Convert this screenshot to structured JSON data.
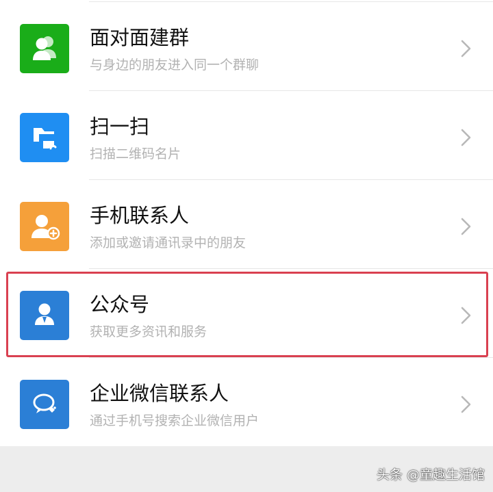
{
  "items": [
    {
      "id": "face-to-face-group",
      "title": "面对面建群",
      "subtitle": "与身边的朋友进入同一个群聊",
      "icon": "face-to-face-group-icon",
      "icon_color": "#1aad19"
    },
    {
      "id": "scan",
      "title": "扫一扫",
      "subtitle": "扫描二维码名片",
      "icon": "scan-icon",
      "icon_color": "#1f8ef2"
    },
    {
      "id": "phone-contacts",
      "title": "手机联系人",
      "subtitle": "添加或邀请通讯录中的朋友",
      "icon": "phone-contact-add-icon",
      "icon_color": "#f5a03a"
    },
    {
      "id": "official-accounts",
      "title": "公众号",
      "subtitle": "获取更多资讯和服务",
      "icon": "official-account-icon",
      "icon_color": "#2b7fd6",
      "highlighted": true
    },
    {
      "id": "wecom-contacts",
      "title": "企业微信联系人",
      "subtitle": "通过手机号搜索企业微信用户",
      "icon": "wecom-contact-icon",
      "icon_color": "#2b7fd6"
    }
  ],
  "highlight_color": "#d94050",
  "watermark": {
    "text": "头条 @童趣生活馆"
  }
}
